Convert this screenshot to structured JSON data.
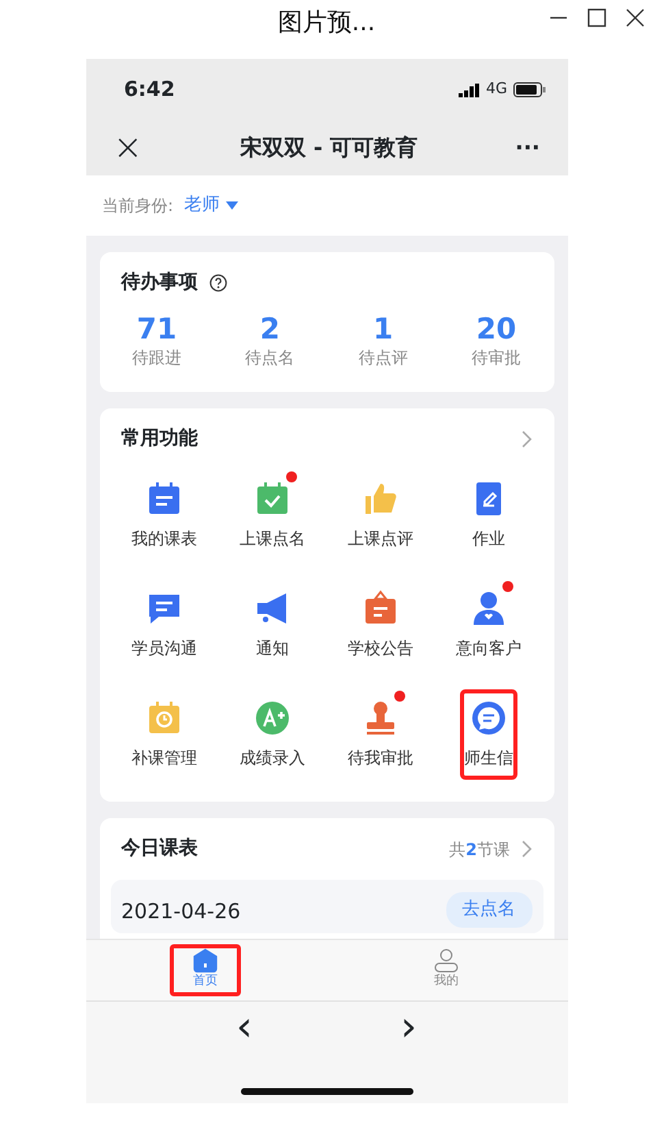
{
  "window": {
    "title": "图片预..."
  },
  "status_bar": {
    "time": "6:42",
    "network": "4G"
  },
  "nav": {
    "close": "×",
    "title": "宋双双 - 可可教育",
    "more": "···"
  },
  "identity": {
    "label": "当前身份:",
    "role": "老师"
  },
  "todo": {
    "title": "待办事项",
    "stats": [
      {
        "value": "71",
        "label": "待跟进"
      },
      {
        "value": "2",
        "label": "待点名"
      },
      {
        "value": "1",
        "label": "待点评"
      },
      {
        "value": "20",
        "label": "待审批"
      }
    ]
  },
  "features": {
    "title": "常用功能",
    "items": [
      {
        "label": "我的课表",
        "badge": false,
        "highlighted": false
      },
      {
        "label": "上课点名",
        "badge": true,
        "highlighted": false
      },
      {
        "label": "上课点评",
        "badge": false,
        "highlighted": false
      },
      {
        "label": "作业",
        "badge": false,
        "highlighted": false
      },
      {
        "label": "学员沟通",
        "badge": false,
        "highlighted": false
      },
      {
        "label": "通知",
        "badge": false,
        "highlighted": false
      },
      {
        "label": "学校公告",
        "badge": false,
        "highlighted": false
      },
      {
        "label": "意向客户",
        "badge": true,
        "highlighted": false
      },
      {
        "label": "补课管理",
        "badge": false,
        "highlighted": false
      },
      {
        "label": "成绩录入",
        "badge": false,
        "highlighted": false
      },
      {
        "label": "待我审批",
        "badge": true,
        "highlighted": false
      },
      {
        "label": "师生信",
        "badge": false,
        "highlighted": true
      }
    ]
  },
  "schedule": {
    "title": "今日课表",
    "count": "共**2**节课",
    "date": "2021-04-26",
    "action": "去点名"
  },
  "tabs": [
    {
      "label": "首页",
      "selected": true,
      "highlighted": true
    },
    {
      "label": "我的",
      "selected": false,
      "highlighted": false
    }
  ],
  "browser_bar": {
    "back": "‹",
    "forward": "›"
  }
}
